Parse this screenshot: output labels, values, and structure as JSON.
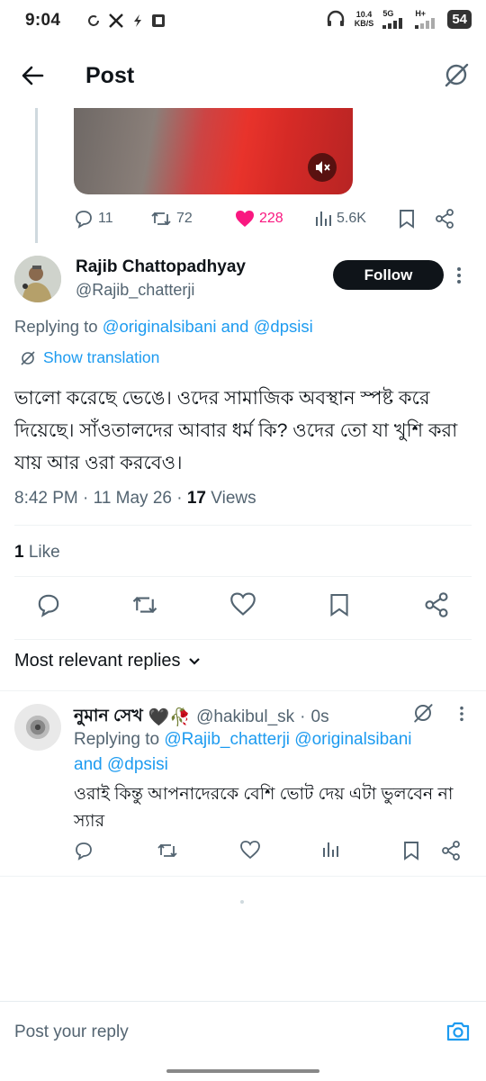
{
  "status_bar": {
    "time": "9:04",
    "network_speed_value": "10.4",
    "network_speed_unit": "KB/S",
    "sim1": "5G",
    "sim2": "H+",
    "battery": "54"
  },
  "header": {
    "title": "Post"
  },
  "parent_tweet": {
    "replies": "11",
    "reposts": "72",
    "likes": "228",
    "views": "5.6K"
  },
  "tweet": {
    "author_name": "Rajib Chattopadhyay",
    "author_handle": "@Rajib_chatterji",
    "follow_label": "Follow",
    "replying_prefix": "Replying to ",
    "replying_mention1": "@originalsibani",
    "replying_and": " and ",
    "replying_mention2": "@dpsisi",
    "translate_label": "Show translation",
    "text": "ভালো করেছে ভেঙে। ওদের সামাজিক অবস্থান স্পষ্ট করে দিয়েছে। সাঁওতালদের আবার ধর্ম কি? ওদের তো যা খুশি করা যায় আর ওরা করবেও।",
    "time": "8:42 PM",
    "date": "11 May 26",
    "views_count": "17",
    "views_label": "Views",
    "like_count": "1",
    "like_label": "Like"
  },
  "replies_section": {
    "sort_label": "Most relevant replies"
  },
  "reply": {
    "name": "নুমান সেখ",
    "emoji": "🖤🥀",
    "handle": "@hakibul_sk",
    "time": "0s",
    "replying_prefix": "Replying to ",
    "mentions_line1": "@Rajib_chatterji @originalsibani",
    "mentions_and": "and ",
    "mentions_line2": "@dpsisi",
    "text": "ওরাই কিন্তু আপনাদেরকে বেশি ভোট দেয় এটা ভুলবেন না স্যার"
  },
  "composer": {
    "placeholder": "Post your reply"
  },
  "colors": {
    "accent": "#1d9bf0",
    "like_pink": "#f91880",
    "text_secondary": "#536471"
  }
}
